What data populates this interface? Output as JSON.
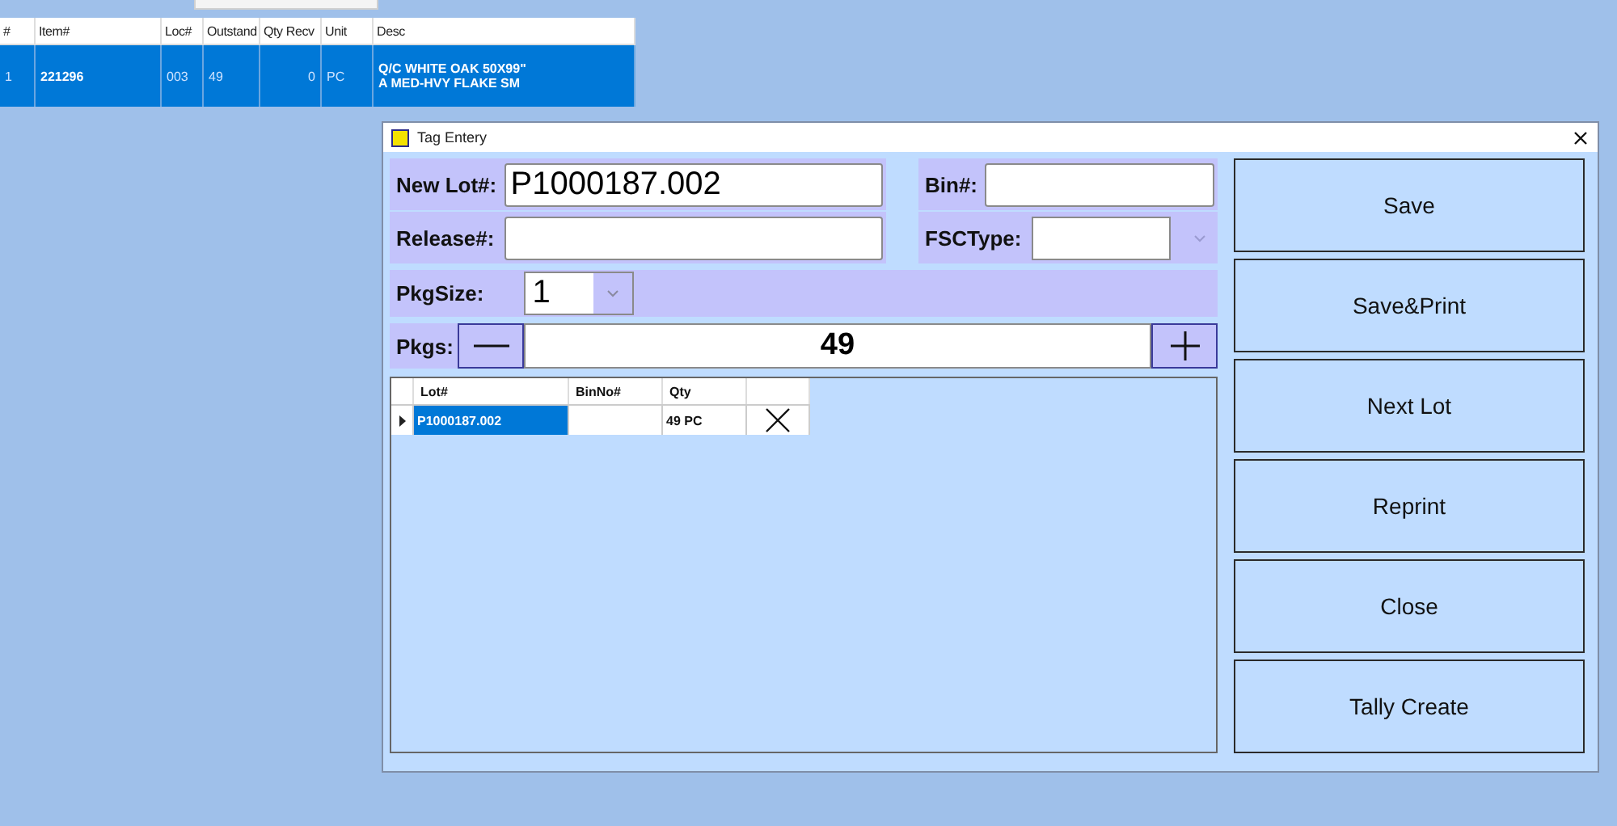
{
  "background_grid": {
    "columns": [
      "#",
      "Item#",
      "Loc#",
      "Outstand",
      "Qty Recv",
      "Unit",
      "Desc"
    ],
    "rows": [
      {
        "selected": true,
        "cells": [
          "1",
          "221296",
          "003",
          "49",
          "0",
          "PC"
        ],
        "desc_lines": [
          "Q/C WHITE OAK 50X99\"",
          "A MED-HVY FLAKE SM"
        ]
      }
    ]
  },
  "dialog": {
    "title": "Tag Entery",
    "new_lot": {
      "label": "New Lot#:",
      "value": "P1000187.002"
    },
    "bin": {
      "label": "Bin#:"
    },
    "release": {
      "label": "Release#:"
    },
    "fsc_type": {
      "label": "FSCType:",
      "disabled": true
    },
    "pkg_size": {
      "label": "PkgSize:",
      "value": "1"
    },
    "pkgs": {
      "label": "Pkgs:",
      "value": "49"
    },
    "lot_grid": {
      "columns": [
        "Lot#",
        "BinNo#",
        "Qty"
      ],
      "rows": [
        {
          "current": true,
          "lot": "P1000187.002",
          "lot_selected": true,
          "qty": "49 PC"
        }
      ]
    },
    "buttons": [
      "Save",
      "Save&Print",
      "Next Lot",
      "Reprint",
      "Close",
      "Tally Create"
    ]
  }
}
